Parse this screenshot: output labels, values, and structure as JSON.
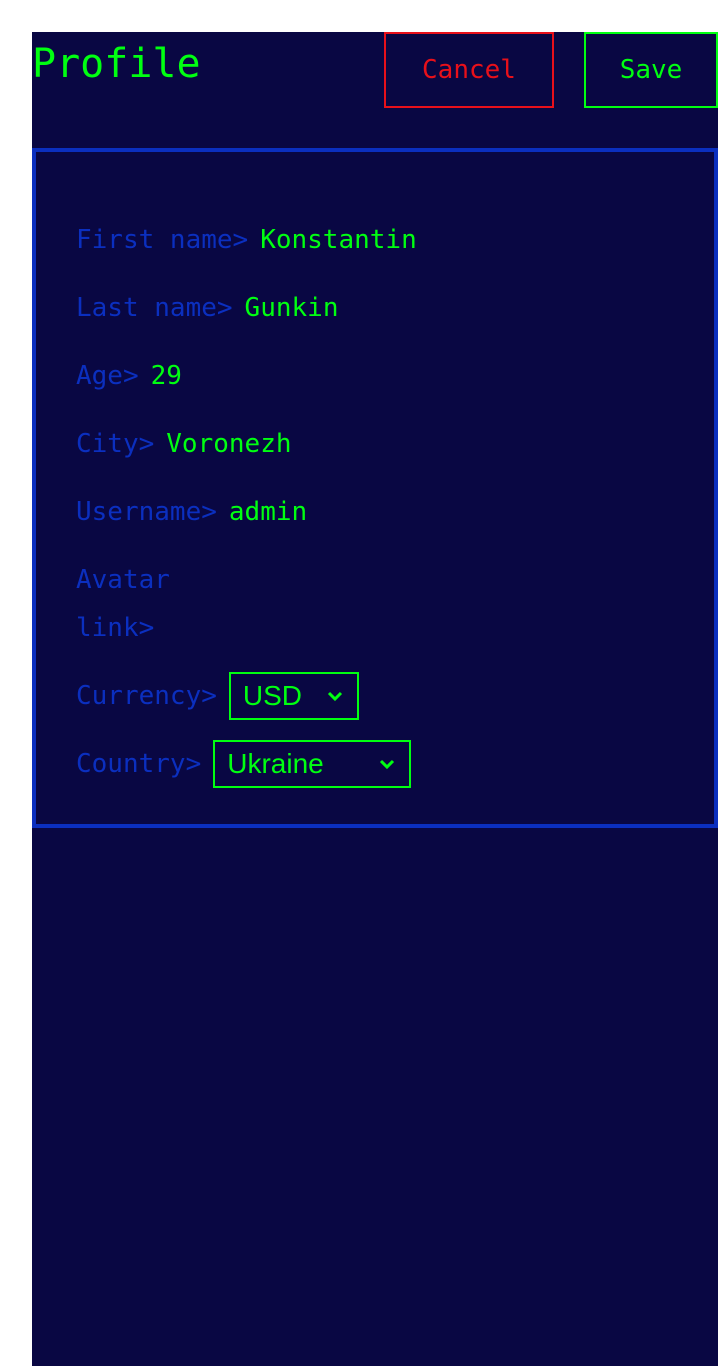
{
  "header": {
    "title": "Profile",
    "cancel_label": "Cancel",
    "save_label": "Save"
  },
  "profile": {
    "fields": [
      {
        "label": "First name>",
        "value": "Konstantin"
      },
      {
        "label": "Last name>",
        "value": "Gunkin"
      },
      {
        "label": "Age>",
        "value": "29"
      },
      {
        "label": "City>",
        "value": "Voronezh"
      },
      {
        "label": "Username>",
        "value": "admin"
      },
      {
        "label": "Avatar link>",
        "value": ""
      }
    ],
    "currency": {
      "label": "Currency>",
      "selected": "USD"
    },
    "country": {
      "label": "Country>",
      "selected": "Ukraine"
    }
  },
  "colors": {
    "background": "#090743",
    "accent_green": "#00ff11",
    "accent_blue": "#0b2fbf",
    "danger_red": "#e8101a"
  },
  "icons": {
    "select_arrow": "chevron-down-icon"
  }
}
